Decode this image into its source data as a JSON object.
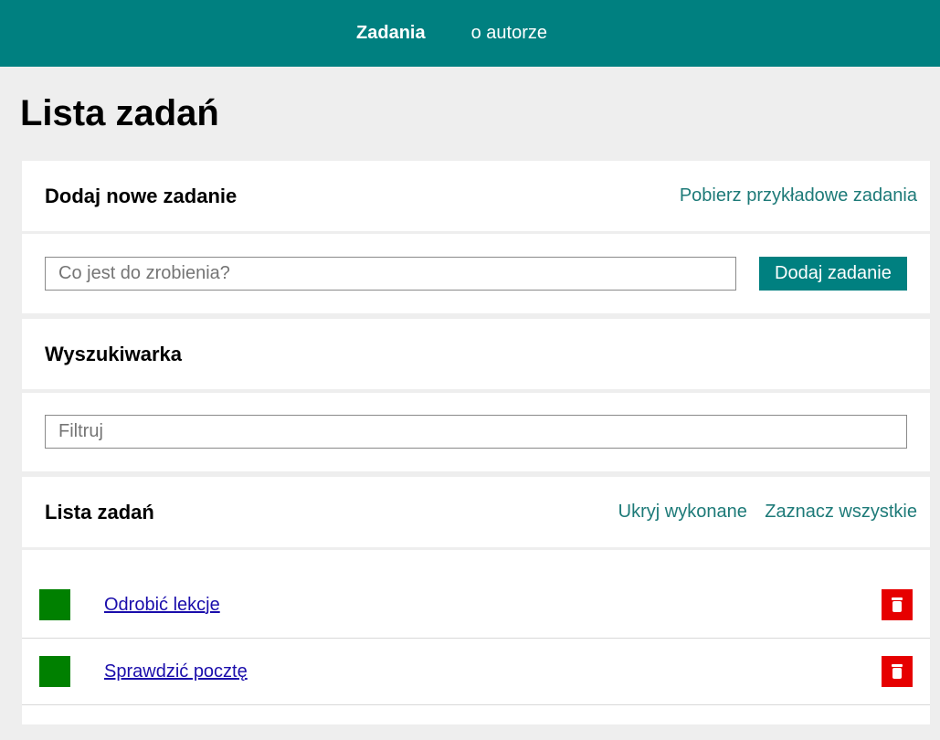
{
  "nav": {
    "items": [
      {
        "label": "Zadania",
        "active": true
      },
      {
        "label": "o autorze",
        "active": false
      }
    ]
  },
  "page_title": "Lista zadań",
  "add_section": {
    "title": "Dodaj nowe zadanie",
    "sample_link": "Pobierz przykładowe zadania",
    "input_value": "",
    "input_placeholder": "Co jest do zrobienia?",
    "button_label": "Dodaj zadanie"
  },
  "search_section": {
    "title": "Wyszukiwarka",
    "input_value": "",
    "input_placeholder": "Filtruj"
  },
  "list_section": {
    "title": "Lista zadań",
    "hide_done_link": "Ukryj wykonane",
    "select_all_link": "Zaznacz wszystkie",
    "tasks": [
      {
        "title": "Odrobić lekcje"
      },
      {
        "title": "Sprawdzić pocztę"
      }
    ]
  },
  "colors": {
    "accent": "#008080",
    "link": "#1d7a78",
    "task_check": "#008000",
    "delete": "#e60000"
  },
  "icons": {
    "task_check": "checkbox-icon",
    "delete": "trash-icon"
  }
}
